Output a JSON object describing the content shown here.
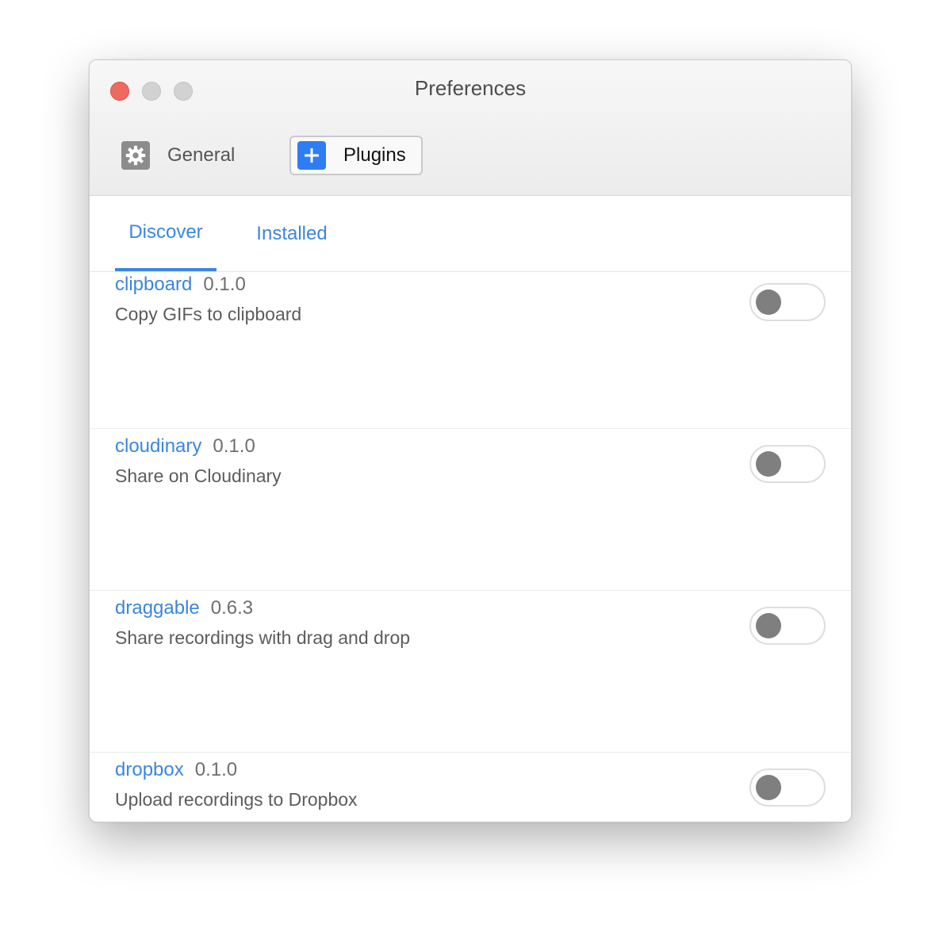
{
  "window": {
    "title": "Preferences"
  },
  "toolbar": {
    "general": {
      "label": "General",
      "icon": "gear-icon"
    },
    "plugins": {
      "label": "Plugins",
      "icon": "plus-icon",
      "selected": true
    }
  },
  "tabs": [
    {
      "label": "Discover",
      "active": true
    },
    {
      "label": "Installed",
      "active": false
    }
  ],
  "plugins": [
    {
      "name": "clipboard",
      "version": "0.1.0",
      "description": "Copy GIFs to clipboard",
      "enabled": false
    },
    {
      "name": "cloudinary",
      "version": "0.1.0",
      "description": "Share on Cloudinary",
      "enabled": false
    },
    {
      "name": "draggable",
      "version": "0.6.3",
      "description": "Share recordings with drag and drop",
      "enabled": false
    },
    {
      "name": "dropbox",
      "version": "0.1.0",
      "description": "Upload recordings to Dropbox",
      "enabled": false
    }
  ],
  "colors": {
    "accent": "#3b86e0",
    "close_button": "#ee6a5e",
    "plugins_icon_bg": "#2f7df4",
    "general_icon_bg": "#8c8c8c",
    "toggle_knob": "#7f7f7f"
  }
}
